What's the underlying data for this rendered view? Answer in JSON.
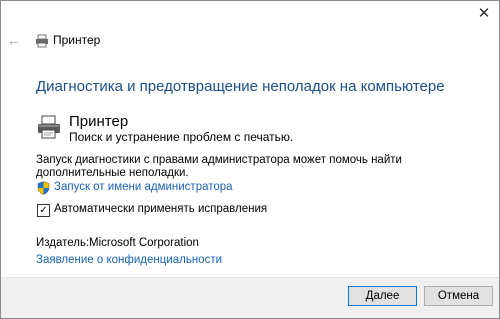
{
  "window": {
    "title": "Принтер"
  },
  "heading": "Диагностика и предотвращение неполадок на компьютере",
  "tool": {
    "name": "Принтер",
    "description": "Поиск и устранение проблем с печатью."
  },
  "admin": {
    "text": "Запуск диагностики с правами администратора может помочь найти дополнительные неполадки.",
    "link": "Запуск от имени администратора"
  },
  "auto_fix": {
    "label": "Автоматически применять исправления",
    "checked": true
  },
  "publisher": {
    "label": "Издатель:",
    "value": "Microsoft Corporation"
  },
  "privacy_link": "Заявление о конфиденциальности",
  "buttons": {
    "next": "Далее",
    "cancel": "Отмена"
  },
  "icons": {
    "close": "close-icon",
    "back": "back-arrow-icon",
    "printer": "printer-icon",
    "shield": "uac-shield-icon",
    "check": "checkmark-icon"
  },
  "colors": {
    "heading": "#1a4f8a",
    "link": "#1a62b0",
    "footer_bg": "#f0f0f0",
    "default_button_border": "#0078d7"
  }
}
